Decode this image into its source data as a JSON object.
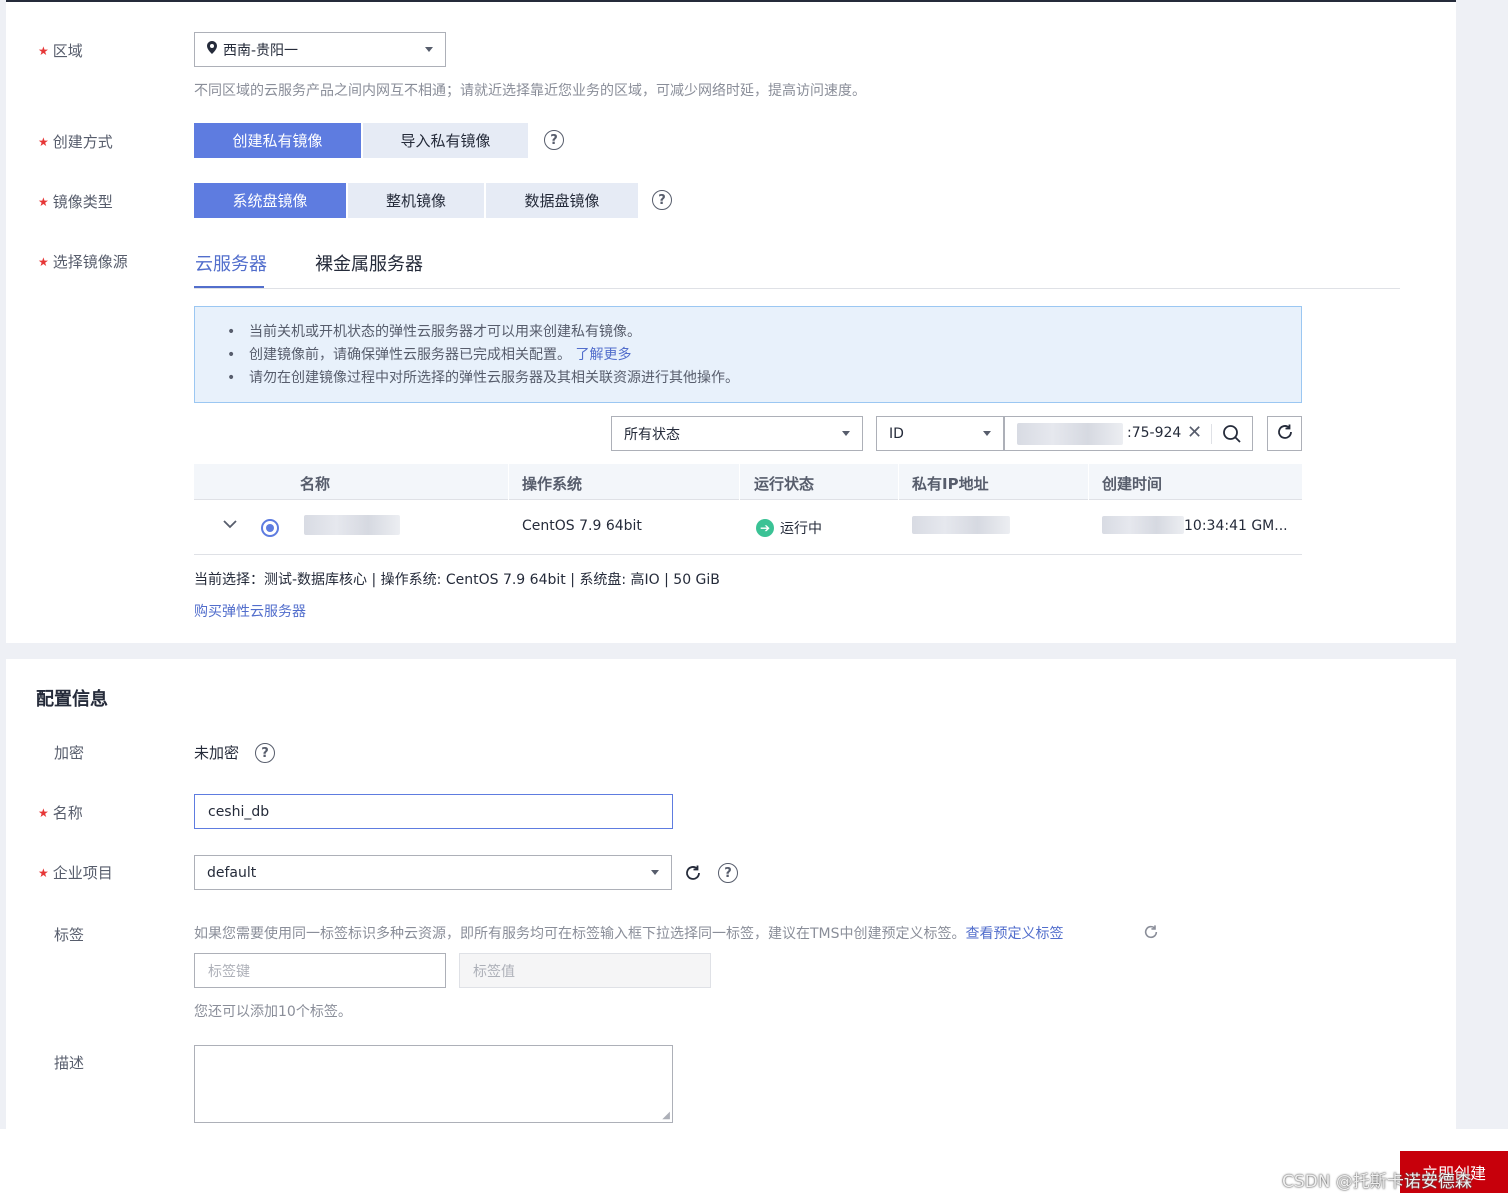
{
  "region": {
    "label": "区域",
    "value": "西南-贵阳一",
    "hint": "不同区域的云服务产品之间内网互不相通；请就近选择靠近您业务的区域，可减少网络时延，提高访问速度。"
  },
  "create_method": {
    "label": "创建方式",
    "options": [
      "创建私有镜像",
      "导入私有镜像"
    ],
    "selected": "创建私有镜像"
  },
  "image_type": {
    "label": "镜像类型",
    "options": [
      "系统盘镜像",
      "整机镜像",
      "数据盘镜像"
    ],
    "selected": "系统盘镜像"
  },
  "image_source": {
    "label": "选择镜像源",
    "tabs": [
      "云服务器",
      "裸金属服务器"
    ],
    "active_tab": "云服务器"
  },
  "notice": {
    "items": [
      "当前关机或开机状态的弹性云服务器才可以用来创建私有镜像。",
      "创建镜像前，请确保弹性云服务器已完成相关配置。",
      "请勿在创建镜像过程中对所选择的弹性云服务器及其相关联资源进行其他操作。"
    ],
    "learn_more": "了解更多"
  },
  "filters": {
    "status": "所有状态",
    "field": "ID",
    "search_value_visible": ":75-924"
  },
  "table": {
    "columns": [
      "名称",
      "操作系统",
      "运行状态",
      "私有IP地址",
      "创建时间"
    ],
    "rows": [
      {
        "os": "CentOS 7.9 64bit",
        "status": "运行中",
        "created_visible": "10:34:41 GM..."
      }
    ]
  },
  "selection": {
    "summary": "当前选择：测试-数据库核心 | 操作系统: CentOS 7.9 64bit | 系统盘: 高IO | 50 GiB",
    "buy_link": "购买弹性云服务器"
  },
  "config": {
    "title": "配置信息",
    "encryption": {
      "label": "加密",
      "value": "未加密"
    },
    "name": {
      "label": "名称",
      "value": "ceshi_db"
    },
    "enterprise_project": {
      "label": "企业项目",
      "value": "default"
    },
    "tags": {
      "label": "标签",
      "hint": "如果您需要使用同一标签标识多种云资源，即所有服务均可在标签输入框下拉选择同一标签，建议在TMS中创建预定义标签。",
      "predefined_link": "查看预定义标签",
      "key_placeholder": "标签键",
      "value_placeholder": "标签值",
      "remaining": "您还可以添加10个标签。"
    },
    "description": {
      "label": "描述",
      "value": ""
    }
  },
  "footer": {
    "submit": "立即创建",
    "watermark": "CSDN @托斯卡诺安德森"
  },
  "colors": {
    "primary": "#5e7ce0",
    "link": "#526ecc",
    "required": "#e63737",
    "running": "#3ac295",
    "submit": "#c7000b"
  }
}
